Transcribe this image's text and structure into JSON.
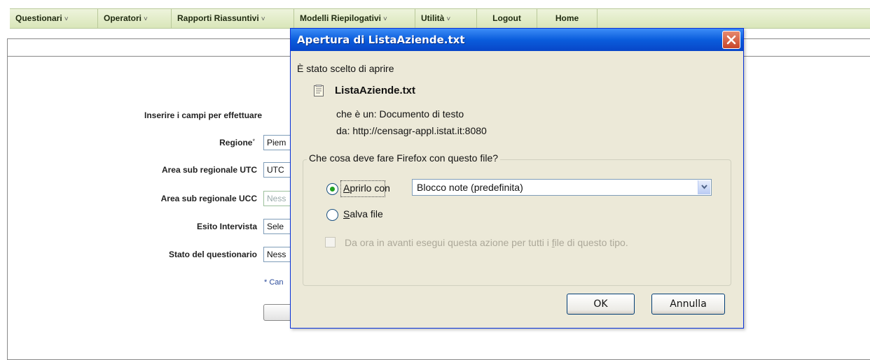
{
  "nav": {
    "items": [
      {
        "label": "Questionari",
        "has_menu": true
      },
      {
        "label": "Operatori",
        "has_menu": true
      },
      {
        "label": "Rapporti Riassuntivi",
        "has_menu": true
      },
      {
        "label": "Modelli Riepilogativi",
        "has_menu": true
      },
      {
        "label": "Utilità",
        "has_menu": true
      },
      {
        "label": "Logout",
        "has_menu": false
      },
      {
        "label": "Home",
        "has_menu": false
      }
    ],
    "chevron": "˅"
  },
  "form": {
    "intro": "Inserire i campi per effettuare",
    "required_mark": "*",
    "fields": [
      {
        "label": "Regione",
        "required": true,
        "value": "Piem"
      },
      {
        "label": "Area sub regionale UTC",
        "required": false,
        "value": "UTC"
      },
      {
        "label": "Area sub regionale UCC",
        "required": false,
        "value": "Ness"
      },
      {
        "label": "Esito Intervista",
        "required": false,
        "value": "Sele"
      },
      {
        "label": "Stato del questionario",
        "required": false,
        "value": "Ness"
      }
    ],
    "note": "* Can"
  },
  "dialog": {
    "title": "Apertura di ListaAziende.txt",
    "chosen_text": "È stato scelto di aprire",
    "file_name": "ListaAziende.txt",
    "type_prefix": "che è un:",
    "type_value": "Documento di testo",
    "from_prefix": "da:",
    "from_value": "http://censagr-appl.istat.it:8080",
    "question": "Che cosa deve fare Firefox con questo file?",
    "open_with_label_access": "A",
    "open_with_label_rest": "prirlo con",
    "open_with_selected": true,
    "app_select_value": "Blocco note (predefinita)",
    "save_label_access": "S",
    "save_label_rest": "alva file",
    "always_label_pre": "Da ora in avanti esegui questa azione per tutti i ",
    "always_label_access": "f",
    "always_label_rest": "ile di questo tipo.",
    "always_checked": false,
    "ok_label": "OK",
    "cancel_label": "Annulla"
  },
  "colors": {
    "titlebar": "#0a5ddc",
    "dialog_bg": "#ece9d8",
    "nav_bg": "#d9e6b9",
    "radio_dot": "#21a121"
  },
  "icons": {
    "close": "close-icon",
    "file": "text-file-icon",
    "dropdown": "chevron-down-icon"
  }
}
